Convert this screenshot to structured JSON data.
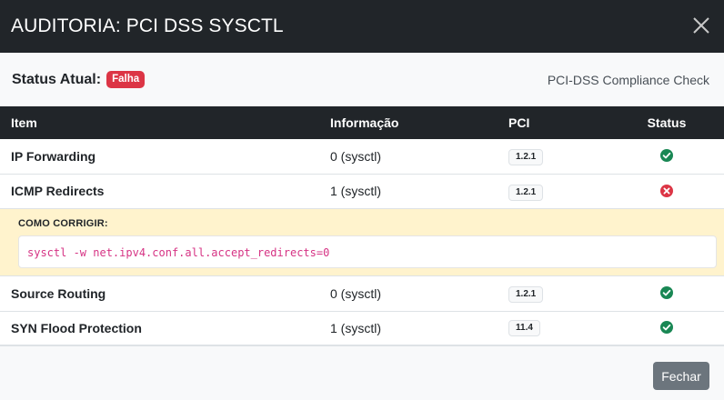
{
  "modal": {
    "title": "AUDITORIA: PCI DSS SYSCTL",
    "close_icon": "close-icon"
  },
  "status": {
    "label": "Status Atual:",
    "badge": "Falha",
    "compliance": "PCI-DSS Compliance Check"
  },
  "table": {
    "headers": {
      "item": "Item",
      "info": "Informação",
      "pci": "PCI",
      "status": "Status"
    },
    "rows": [
      {
        "item": "IP Forwarding",
        "info": "0 (sysctl)",
        "pci": "1.2.1",
        "status": "pass"
      },
      {
        "item": "ICMP Redirects",
        "info": "1 (sysctl)",
        "pci": "1.2.1",
        "status": "fail"
      },
      {
        "item": "Source Routing",
        "info": "0 (sysctl)",
        "pci": "1.2.1",
        "status": "pass"
      },
      {
        "item": "SYN Flood Protection",
        "info": "1 (sysctl)",
        "pci": "11.4",
        "status": "pass"
      }
    ],
    "fix": {
      "label": "COMO CORRIGIR:",
      "command": "sysctl -w net.ipv4.conf.all.accept_redirects=0"
    }
  },
  "footer": {
    "close_label": "Fechar"
  },
  "colors": {
    "header_bg": "#212529",
    "fail": "#dc3545",
    "pass": "#198754",
    "fix_bg": "#fff3cd",
    "code_text": "#d63384",
    "button_bg": "#6c757d"
  }
}
